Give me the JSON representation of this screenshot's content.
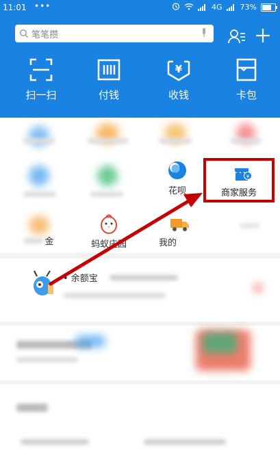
{
  "status_bar": {
    "time": "11:01",
    "dots": "•••",
    "network": "4G",
    "battery": "73%"
  },
  "search": {
    "placeholder": "笔笔攒"
  },
  "quick_actions": [
    {
      "label": "扫一扫",
      "icon": "scan-icon"
    },
    {
      "label": "付钱",
      "icon": "barcode-icon"
    },
    {
      "label": "收钱",
      "icon": "yuan-icon"
    },
    {
      "label": "卡包",
      "icon": "card-icon"
    }
  ],
  "grid": {
    "huabei_label": "花呗",
    "merchant_label": "商家服务",
    "ant_farm_label": "蚂蚁庄园",
    "partial_left_label": "金",
    "partial_right_label": "我的"
  },
  "notice": {
    "text": "• 余额宝"
  },
  "colors": {
    "brand": "#1a82e0",
    "highlight": "#c40000"
  }
}
